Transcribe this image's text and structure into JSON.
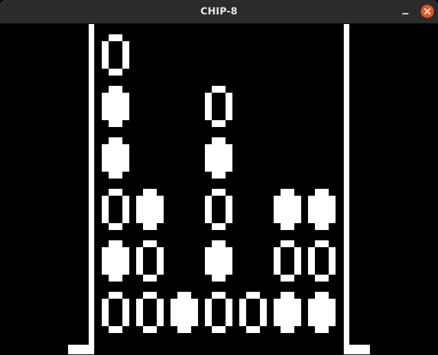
{
  "window": {
    "title": "CHIP-8",
    "controls": {
      "minimize_icon": "minimize-icon",
      "close_icon": "close-icon"
    },
    "colors": {
      "titlebar": "#2b2b2b",
      "title_text": "#e6e6e6",
      "close_button": "#e9541f",
      "screen_background": "#000000",
      "pixel_on": "#ffffff"
    }
  },
  "game": {
    "grid_columns": 7,
    "grid_rows": 6,
    "piece_types": [
      "hollow-ring",
      "solid-diamond"
    ],
    "board": [
      [
        "hollow-ring",
        null,
        null,
        null,
        null,
        null,
        null
      ],
      [
        "solid-diamond",
        null,
        null,
        "hollow-ring",
        null,
        null,
        null
      ],
      [
        "solid-diamond",
        null,
        null,
        "solid-diamond",
        null,
        null,
        null
      ],
      [
        "hollow-ring",
        "solid-diamond",
        null,
        "hollow-ring",
        null,
        "solid-diamond",
        "solid-diamond"
      ],
      [
        "solid-diamond",
        "hollow-ring",
        null,
        "solid-diamond",
        null,
        "hollow-ring",
        "hollow-ring"
      ],
      [
        "hollow-ring",
        "hollow-ring",
        "solid-diamond",
        "hollow-ring",
        "hollow-ring",
        "solid-diamond",
        "solid-diamond"
      ]
    ]
  }
}
